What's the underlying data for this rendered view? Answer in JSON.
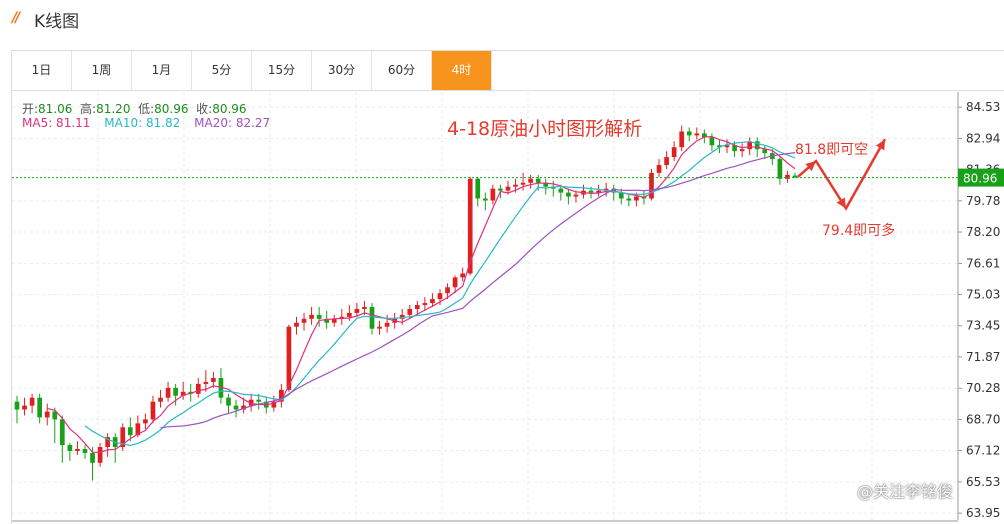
{
  "app": {
    "title": "K线图"
  },
  "tabs": [
    {
      "label": "1日",
      "active": false
    },
    {
      "label": "1周",
      "active": false
    },
    {
      "label": "1月",
      "active": false
    },
    {
      "label": "5分",
      "active": false
    },
    {
      "label": "15分",
      "active": false
    },
    {
      "label": "30分",
      "active": false
    },
    {
      "label": "60分",
      "active": false
    },
    {
      "label": "4时",
      "active": true
    }
  ],
  "ohlc": {
    "open_label": "开:",
    "open": "81.06",
    "high_label": "高:",
    "high": "81.20",
    "low_label": "低:",
    "low": "80.96",
    "close_label": "收:",
    "close": "80.96"
  },
  "ma": {
    "ma5": "MA5: 81.11",
    "ma10": "MA10: 81.82",
    "ma20": "MA20: 82.27",
    "colors": {
      "ma5": "#e0307a",
      "ma10": "#28b8c8",
      "ma20": "#a050c0"
    }
  },
  "headline": "4-18原油小时图形解析",
  "annotations": {
    "short": "81.8即可空",
    "long": "79.4即可多"
  },
  "watermark": "@关注李铭俊",
  "colors": {
    "up": "#e02020",
    "down": "#18a018",
    "accent": "#f7941d",
    "price_tag": "#18a018"
  },
  "chart_data": {
    "type": "candlestick",
    "current_price": "80.96",
    "y_ticks": [
      "84.53",
      "82.94",
      "81.36",
      "79.78",
      "78.20",
      "76.61",
      "75.03",
      "73.45",
      "71.87",
      "70.28",
      "68.70",
      "67.12",
      "65.53",
      "63.95"
    ],
    "ylim": [
      63.6,
      85.3
    ],
    "candles": [
      [
        69.6,
        69.2,
        69.9,
        68.5
      ],
      [
        69.2,
        69.4,
        69.8,
        68.9
      ],
      [
        69.4,
        69.8,
        70.0,
        69.0
      ],
      [
        69.8,
        68.8,
        70.0,
        68.5
      ],
      [
        68.8,
        69.1,
        69.5,
        68.4
      ],
      [
        69.1,
        68.7,
        69.3,
        67.5
      ],
      [
        68.7,
        67.4,
        68.9,
        66.5
      ],
      [
        67.4,
        67.1,
        67.5,
        66.6
      ],
      [
        67.1,
        67.2,
        67.6,
        66.9
      ],
      [
        67.2,
        67.0,
        67.4,
        66.7
      ],
      [
        67.0,
        66.5,
        67.3,
        65.6
      ],
      [
        66.5,
        67.3,
        67.5,
        66.3
      ],
      [
        67.3,
        67.8,
        68.0,
        66.8
      ],
      [
        67.8,
        67.3,
        68.0,
        66.5
      ],
      [
        67.3,
        68.3,
        68.5,
        67.1
      ],
      [
        68.3,
        67.9,
        68.8,
        67.6
      ],
      [
        67.9,
        68.5,
        68.9,
        67.8
      ],
      [
        68.5,
        68.7,
        69.0,
        68.2
      ],
      [
        68.7,
        69.6,
        69.9,
        68.5
      ],
      [
        69.6,
        69.8,
        70.2,
        69.3
      ],
      [
        69.8,
        70.3,
        70.6,
        69.6
      ],
      [
        70.3,
        69.9,
        70.5,
        69.4
      ],
      [
        69.9,
        70.1,
        70.6,
        69.7
      ],
      [
        70.1,
        70.0,
        70.5,
        69.6
      ],
      [
        70.0,
        70.5,
        70.8,
        69.8
      ],
      [
        70.5,
        70.6,
        71.2,
        70.1
      ],
      [
        70.6,
        70.8,
        71.1,
        70.3
      ],
      [
        70.8,
        69.8,
        71.3,
        69.5
      ],
      [
        69.8,
        69.4,
        70.0,
        69.0
      ],
      [
        69.4,
        69.2,
        69.7,
        68.8
      ],
      [
        69.2,
        69.4,
        69.8,
        69.0
      ],
      [
        69.4,
        69.7,
        70.0,
        69.1
      ],
      [
        69.7,
        69.6,
        70.0,
        69.2
      ],
      [
        69.6,
        69.3,
        69.8,
        69.0
      ],
      [
        69.3,
        69.6,
        69.9,
        69.1
      ],
      [
        69.6,
        70.2,
        70.5,
        69.3
      ],
      [
        70.2,
        73.4,
        73.5,
        70.1
      ],
      [
        73.4,
        73.6,
        73.9,
        73.0
      ],
      [
        73.6,
        73.8,
        74.1,
        73.2
      ],
      [
        73.8,
        74.0,
        74.4,
        73.5
      ],
      [
        74.0,
        73.8,
        74.4,
        73.4
      ],
      [
        73.8,
        73.6,
        74.2,
        73.3
      ],
      [
        73.6,
        73.8,
        74.0,
        73.4
      ],
      [
        73.8,
        73.9,
        74.3,
        73.5
      ],
      [
        73.9,
        74.1,
        74.5,
        73.7
      ],
      [
        74.1,
        74.3,
        74.6,
        73.9
      ],
      [
        74.3,
        74.4,
        74.7,
        74.0
      ],
      [
        74.4,
        73.3,
        74.6,
        73.0
      ],
      [
        73.3,
        73.4,
        73.7,
        73.0
      ],
      [
        73.4,
        73.6,
        74.0,
        73.1
      ],
      [
        73.6,
        73.8,
        74.1,
        73.3
      ],
      [
        73.8,
        74.0,
        74.3,
        73.5
      ],
      [
        74.0,
        74.3,
        74.5,
        73.8
      ],
      [
        74.3,
        74.5,
        74.7,
        74.0
      ],
      [
        74.5,
        74.6,
        74.9,
        74.2
      ],
      [
        74.6,
        74.8,
        75.1,
        74.4
      ],
      [
        74.8,
        75.1,
        75.3,
        74.5
      ],
      [
        75.1,
        75.4,
        75.6,
        74.8
      ],
      [
        75.4,
        75.9,
        76.0,
        75.1
      ],
      [
        75.9,
        76.1,
        76.4,
        75.7
      ],
      [
        76.1,
        80.9,
        81.0,
        76.0
      ],
      [
        80.9,
        79.9,
        81.0,
        79.5
      ],
      [
        79.9,
        79.8,
        80.2,
        79.3
      ],
      [
        79.8,
        80.4,
        80.6,
        79.6
      ],
      [
        80.4,
        80.3,
        80.6,
        79.9
      ],
      [
        80.3,
        80.5,
        80.8,
        80.1
      ],
      [
        80.5,
        80.6,
        80.9,
        80.2
      ],
      [
        80.6,
        80.7,
        81.2,
        80.3
      ],
      [
        80.7,
        80.9,
        81.1,
        80.4
      ],
      [
        80.9,
        80.7,
        81.1,
        80.3
      ],
      [
        80.7,
        80.5,
        80.9,
        80.1
      ],
      [
        80.5,
        80.4,
        80.8,
        80.0
      ],
      [
        80.4,
        80.2,
        80.6,
        79.8
      ],
      [
        80.2,
        80.0,
        80.4,
        79.6
      ],
      [
        80.0,
        80.1,
        80.3,
        79.7
      ],
      [
        80.1,
        80.3,
        80.6,
        79.9
      ],
      [
        80.3,
        80.2,
        80.5,
        79.9
      ],
      [
        80.2,
        80.3,
        80.6,
        80.0
      ],
      [
        80.3,
        80.4,
        80.7,
        80.0
      ],
      [
        80.4,
        80.2,
        80.6,
        79.8
      ],
      [
        80.2,
        79.9,
        80.4,
        79.6
      ],
      [
        79.9,
        79.8,
        80.1,
        79.5
      ],
      [
        79.8,
        80.0,
        80.2,
        79.5
      ],
      [
        80.0,
        79.9,
        80.3,
        79.6
      ],
      [
        79.9,
        81.2,
        81.4,
        79.8
      ],
      [
        81.2,
        81.6,
        81.9,
        81.0
      ],
      [
        81.6,
        82.0,
        82.3,
        81.4
      ],
      [
        82.0,
        82.5,
        82.8,
        81.8
      ],
      [
        82.5,
        83.3,
        83.6,
        82.3
      ],
      [
        83.3,
        83.1,
        83.5,
        82.8
      ],
      [
        83.1,
        83.2,
        83.5,
        82.9
      ],
      [
        83.2,
        83.0,
        83.4,
        82.7
      ],
      [
        83.0,
        82.6,
        83.2,
        82.3
      ],
      [
        82.6,
        82.5,
        82.9,
        82.2
      ],
      [
        82.5,
        82.6,
        82.9,
        82.2
      ],
      [
        82.6,
        82.3,
        82.8,
        82.0
      ],
      [
        82.3,
        82.4,
        82.7,
        82.0
      ],
      [
        82.4,
        82.8,
        83.0,
        82.1
      ],
      [
        82.8,
        82.4,
        83.0,
        82.0
      ],
      [
        82.4,
        82.2,
        82.6,
        81.9
      ],
      [
        82.2,
        81.9,
        82.4,
        81.6
      ],
      [
        81.9,
        80.9,
        82.0,
        80.6
      ],
      [
        80.9,
        81.1,
        81.3,
        80.7
      ],
      [
        81.06,
        80.96,
        81.2,
        80.96
      ]
    ],
    "ma_source": [
      "MA5",
      "MA10",
      "MA20"
    ],
    "projection": [
      [
        81.0,
        81.8,
        79.4,
        82.9
      ]
    ]
  }
}
